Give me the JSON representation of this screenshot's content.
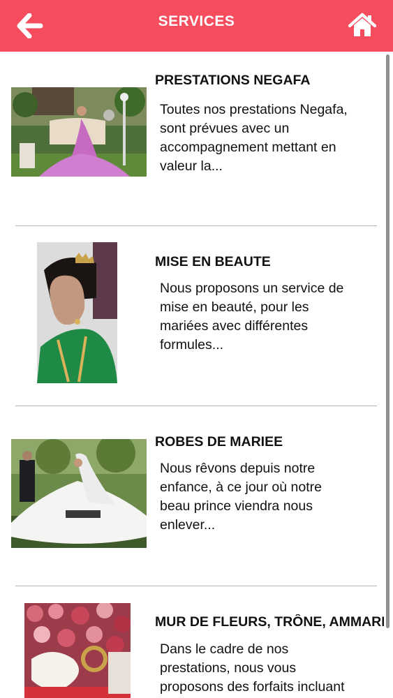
{
  "header": {
    "title": "SERVICES",
    "back_icon": "arrow-left-icon",
    "home_icon": "home-icon",
    "background_color": "#f54d5e"
  },
  "services": [
    {
      "title": "PRESTATIONS NEGAFA",
      "description_lines": [
        "Toutes nos prestations Negafa,",
        "sont prévues avec un",
        "accompagnement mettant en",
        "valeur la..."
      ],
      "image": "bride-on-throne-photo"
    },
    {
      "title": "MISE EN BEAUTE",
      "description_lines": [
        "Nous proposons un service de",
        "mise en beauté, pour les",
        "mariées avec différentes",
        "formules..."
      ],
      "image": "bride-makeup-photo"
    },
    {
      "title": "ROBES DE MARIEE",
      "description_lines": [
        "Nous rêvons depuis notre",
        "enfance, à ce jour où notre",
        "beau prince viendra nous",
        "enlever..."
      ],
      "image": "wedding-dress-photo"
    },
    {
      "title": "MUR DE FLEURS, TRÔNE, AMMARIYA",
      "description_lines": [
        "Dans le cadre de nos",
        "prestations, nous vous",
        "proposons des forfaits incluant"
      ],
      "image": "flower-wall-photo"
    }
  ]
}
